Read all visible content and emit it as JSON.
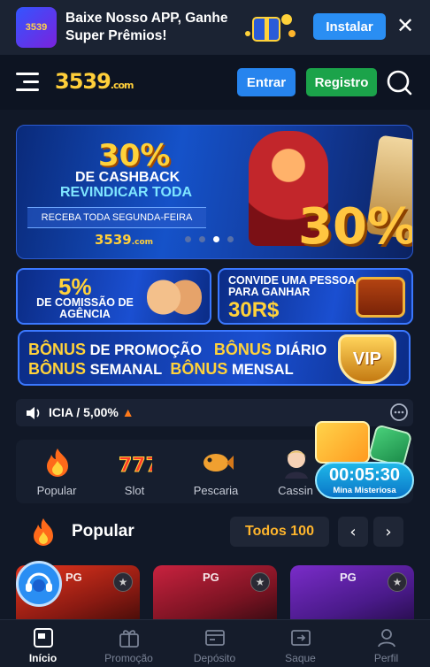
{
  "app_banner": {
    "logo_text": "3539",
    "text": "Baixe Nosso APP, Ganhe Super Prêmios!",
    "install_label": "Instalar",
    "close_symbol": "✕"
  },
  "header": {
    "logo_main": "3539",
    "logo_suffix": ".com",
    "login_label": "Entrar",
    "register_label": "Registro"
  },
  "hero": {
    "percent": "30%",
    "line1": "DE CASHBACK",
    "line2": "REVINDICAR TODA",
    "line3": "RECEBA TODA SEGUNDA-FEIRA",
    "logo": "3539",
    "logo_suffix": ".com",
    "big_percent": "30%",
    "slides_total": 4,
    "active_slide": 3
  },
  "promo_cards": {
    "agency": {
      "percent": "5%",
      "text": "DE COMISSÃO DE AGÊNCIA"
    },
    "invite": {
      "text": "CONVIDE UMA PESSOA PARA GANHAR",
      "value": "30R$"
    },
    "bonus": {
      "row1_a": "BÔNUS",
      "row1_b": "DE PROMOÇÃO",
      "row1_c": "BÔNUS",
      "row1_d": "DIÁRIO",
      "row2_a": "BÔNUS",
      "row2_b": "SEMANAL",
      "row2_c": "BÔNUS",
      "row2_d": "MENSAL",
      "vip": "VIP"
    }
  },
  "marquee": {
    "text": "ICIA / 5,00%"
  },
  "categories": [
    {
      "label": "Popular",
      "icon": "fire-icon"
    },
    {
      "label": "Slot",
      "icon": "slot-777-icon"
    },
    {
      "label": "Pescaria",
      "icon": "fish-icon"
    },
    {
      "label": "Cassin",
      "icon": "dealer-icon"
    }
  ],
  "mystery_box": {
    "timer": "00:05:30",
    "label": "Mina Misteriosa"
  },
  "popular": {
    "title": "Popular",
    "all_label": "Todos 100",
    "prev": "‹",
    "next": "›"
  },
  "games": [
    {
      "provider": "PG"
    },
    {
      "provider": "PG"
    },
    {
      "provider": "PG"
    }
  ],
  "bottom_nav": [
    {
      "label": "Início",
      "icon": "home-icon",
      "active": true
    },
    {
      "label": "Promoção",
      "icon": "gift-icon",
      "active": false
    },
    {
      "label": "Depósito",
      "icon": "deposit-icon",
      "active": false
    },
    {
      "label": "Saque",
      "icon": "withdraw-icon",
      "active": false
    },
    {
      "label": "Perfil",
      "icon": "profile-icon",
      "active": false
    }
  ],
  "colors": {
    "accent_blue": "#2684ee",
    "register_green": "#1ba34a",
    "gold": "#ffd23a",
    "background": "#111827"
  }
}
